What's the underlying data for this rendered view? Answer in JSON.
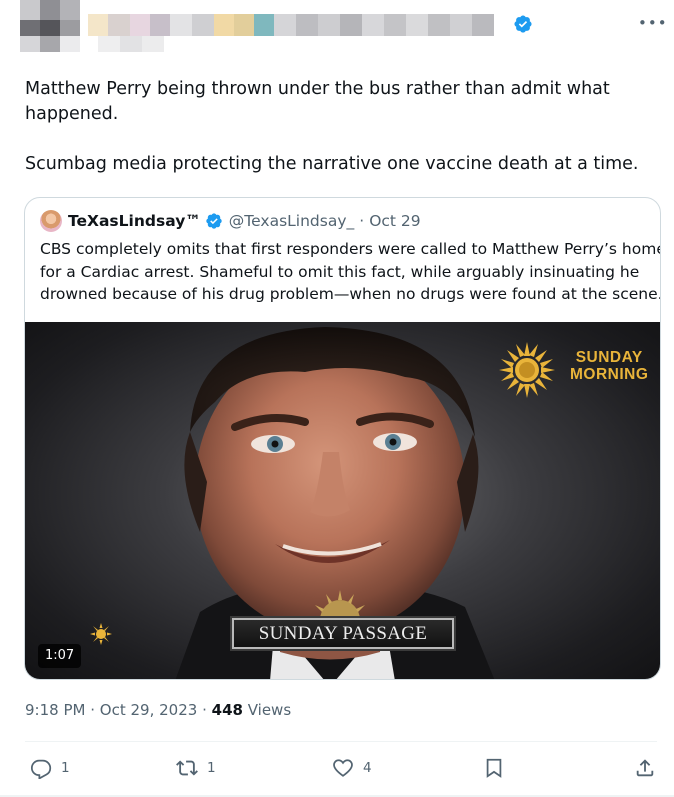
{
  "author": {
    "verified": true
  },
  "tweet": {
    "lines": [
      "Matthew Perry being thrown under the bus rather than admit what",
      "happened."
    ],
    "line3": "Scumbag media protecting the narrative one vaccine death at a time."
  },
  "quote": {
    "name": "TeXasLindsay™",
    "handle": "@TexasLindsay_",
    "separator": "·",
    "date": "Oct 29",
    "text_lines": [
      "CBS completely omits that first responders were called to Matthew Perry’s home",
      "for a Cardiac arrest. Shameful to omit this fact, while arguably insinuating he",
      "drowned because of his drug problem—when no drugs were found at the scene."
    ],
    "media": {
      "logo_line1": "SUNDAY",
      "logo_line2": "MORNING",
      "banner": "SUNDAY PASSAGE",
      "duration": "1:07"
    }
  },
  "meta": {
    "time": "9:18 PM",
    "dot": "·",
    "date": "Oct 29, 2023",
    "dot2": "·",
    "views_count": "448",
    "views_label": "Views"
  },
  "actions": {
    "replies": "1",
    "retweets": "1",
    "likes": "4"
  },
  "colors": {
    "accent": "#1d9bf0",
    "secondary_text": "#536471",
    "border": "#cfd9de",
    "logo_gold": "#e9b43a"
  },
  "icons": [
    "verified-badge-icon",
    "more-icon",
    "sun-logo-icon",
    "reply-icon",
    "retweet-icon",
    "like-icon",
    "bookmark-icon",
    "share-icon"
  ]
}
